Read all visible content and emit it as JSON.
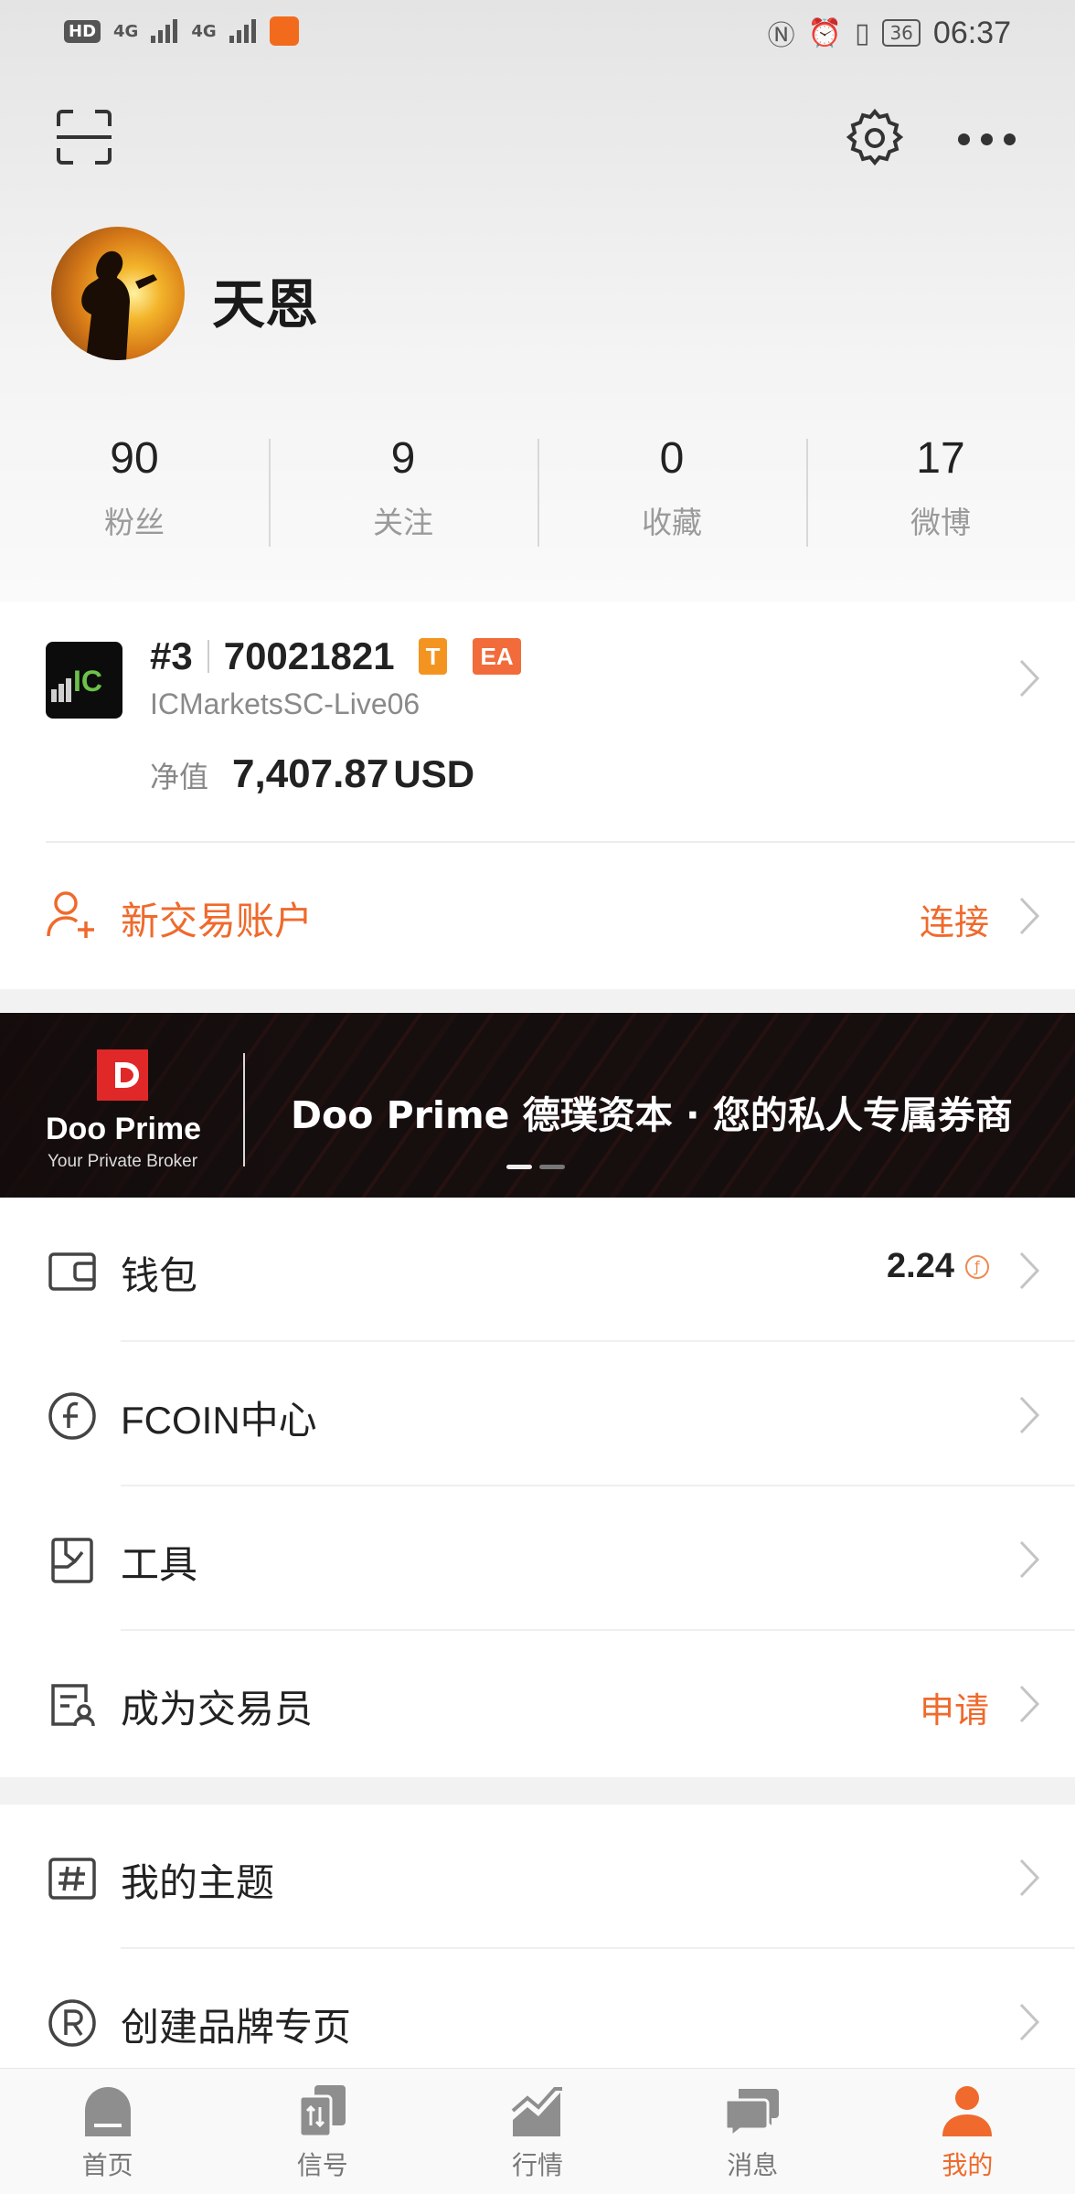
{
  "status_bar": {
    "network_hd": "HD",
    "signal1": "4G",
    "signal2": "4G",
    "battery": "36",
    "time": "06:37"
  },
  "profile": {
    "name": "天恩",
    "stats": [
      {
        "value": "90",
        "label": "粉丝"
      },
      {
        "value": "9",
        "label": "关注"
      },
      {
        "value": "0",
        "label": "收藏"
      },
      {
        "value": "17",
        "label": "微博"
      }
    ]
  },
  "account": {
    "rank": "#3",
    "number": "70021821",
    "tag_t": "T",
    "tag_ea": "EA",
    "server": "ICMarketsSC-Live06",
    "equity_label": "净值",
    "equity_value": "7,407.87",
    "equity_currency": "USD",
    "new_account_label": "新交易账户",
    "connect_label": "连接"
  },
  "banner": {
    "brand": "Doo Prime",
    "subtitle": "Your Private Broker",
    "text": "Doo Prime 德璞资本 · 您的私人专属券商"
  },
  "menu_group1": [
    {
      "label": "钱包",
      "icon": "wallet-icon",
      "value": "2.24",
      "value_icon": "fcoin-icon"
    },
    {
      "label": "FCOIN中心",
      "icon": "fcoin-center-icon"
    },
    {
      "label": "工具",
      "icon": "tools-icon"
    },
    {
      "label": "成为交易员",
      "icon": "trader-icon",
      "action": "申请"
    }
  ],
  "menu_group2": [
    {
      "label": "我的主题",
      "icon": "hashtag-icon"
    },
    {
      "label": "创建品牌专页",
      "icon": "registered-icon"
    }
  ],
  "tabbar": [
    {
      "label": "首页",
      "icon": "home-icon"
    },
    {
      "label": "信号",
      "icon": "signal-icon"
    },
    {
      "label": "行情",
      "icon": "market-icon"
    },
    {
      "label": "消息",
      "icon": "message-icon"
    },
    {
      "label": "我的",
      "icon": "profile-icon",
      "active": true
    }
  ],
  "colors": {
    "accent": "#ef6a2c",
    "tag_t": "#f39421",
    "tag_ea": "#f26b3a"
  }
}
